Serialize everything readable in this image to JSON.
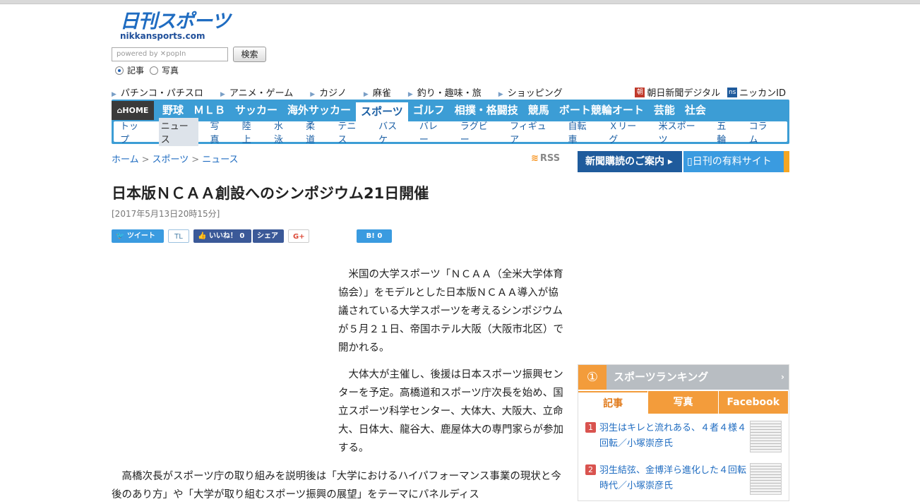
{
  "header": {
    "logo_main": "日刊スポーツ",
    "logo_sub": "nikkansports.com",
    "search_placeholder": "powered by ✕popIn",
    "search_button": "検索",
    "radio_article": "記事",
    "radio_photo": "写真"
  },
  "subnav": {
    "items": [
      "パチンコ・パチスロ",
      "アニメ・ゲーム",
      "カジノ",
      "麻雀",
      "釣り・趣味・旅",
      "ショッピング"
    ],
    "asahi": "朝日新聞デジタル",
    "asahi_badge": "朝",
    "nikkan_id": "ニッカンID",
    "ns_badge": "ns"
  },
  "nav": {
    "home": "HOME",
    "tabs": [
      "野球",
      "ＭＬＢ",
      "サッカー",
      "海外サッカー",
      "スポーツ",
      "ゴルフ",
      "相撲・格闘技",
      "競馬",
      "ボート競輪オート",
      "芸能",
      "社会"
    ],
    "subtabs": [
      "トップ",
      "ニュース",
      "写真",
      "陸上",
      "水泳",
      "柔道",
      "テニス",
      "バスケ",
      "バレー",
      "ラグビー",
      "フィギュア",
      "自転車",
      "Ｘリーグ",
      "米スポーツ",
      "五輪",
      "コラム"
    ]
  },
  "breadcrumb": {
    "home": "ホーム",
    "sports": "スポーツ",
    "news": "ニュース"
  },
  "rss": "RSS",
  "promo": {
    "subscribe": "新聞購読のご案内",
    "paid": "日刊の有料サイト"
  },
  "article": {
    "title": "日本版ＮＣＡＡ創設へのシンポジウム21日開催",
    "date": "[2017年5月13日20時15分]",
    "p1": "　米国の大学スポーツ「ＮＣＡＡ（全米大学体育協会）」をモデルとした日本版ＮＣＡＡ導入が協議されている大学スポーツを考えるシンポジウムが５月２１日、帝国ホテル大阪（大阪市北区）で開かれる。",
    "p2": "　大体大が主催し、後援は日本スポーツ振興センターを予定。高橋道和スポーツ庁次長を始め、国立スポーツ科学センター、大体大、大阪大、立命大、日体大、龍谷大、鹿屋体大の専門家らが参加する。",
    "p3": "　高橋次長がスポーツ庁の取り組みを説明後は「大学におけるハイパフォーマンス事業の現状と今後のあり方」や「大学が取り組むスポーツ振興の展望」をテーマにパネルディス"
  },
  "social": {
    "tweet": "ツイート",
    "tl": "TL",
    "like": "いいね！",
    "like_count": "0",
    "share": "シェア",
    "gplus": "G+",
    "hatena": "B!",
    "hatena_count": "0"
  },
  "ranking": {
    "title": "スポーツランキング",
    "tabs": [
      "記事",
      "写真",
      "Facebook"
    ],
    "items": [
      {
        "num": "1",
        "text": "羽生はキレと流れある、４者４様４回転／小塚崇彦氏"
      },
      {
        "num": "2",
        "text": "羽生結弦、金博洋ら進化した４回転時代／小塚崇彦氏"
      }
    ]
  }
}
